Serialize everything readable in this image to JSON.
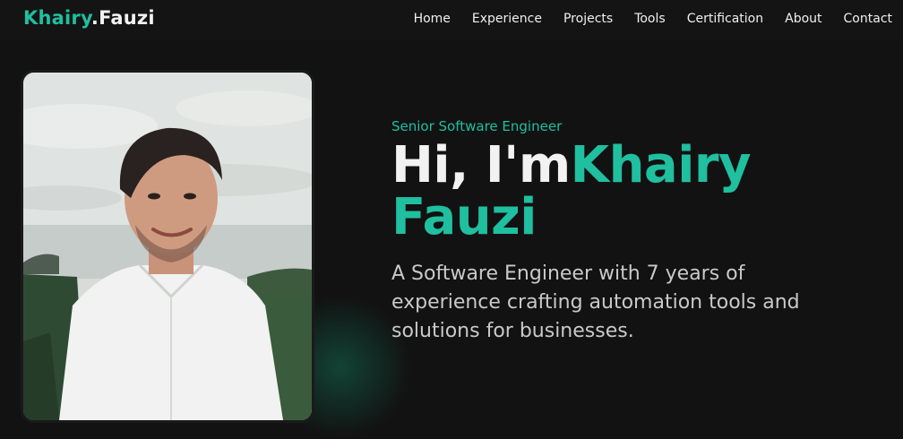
{
  "logo": {
    "first": "Khairy",
    "last": ".Fauzi"
  },
  "nav": {
    "items": [
      {
        "label": "Home"
      },
      {
        "label": "Experience"
      },
      {
        "label": "Projects"
      },
      {
        "label": "Tools"
      },
      {
        "label": "Certification"
      },
      {
        "label": "About"
      },
      {
        "label": "Contact"
      }
    ]
  },
  "hero": {
    "subtitle": "Senior Software Engineer",
    "greeting": "Hi, I'm",
    "name": "Khairy Fauzi",
    "description": "A Software Engineer with 7 years of experience crafting automation tools and solutions for businesses."
  },
  "colors": {
    "accent": "#1fbf9f",
    "background": "#121212"
  }
}
